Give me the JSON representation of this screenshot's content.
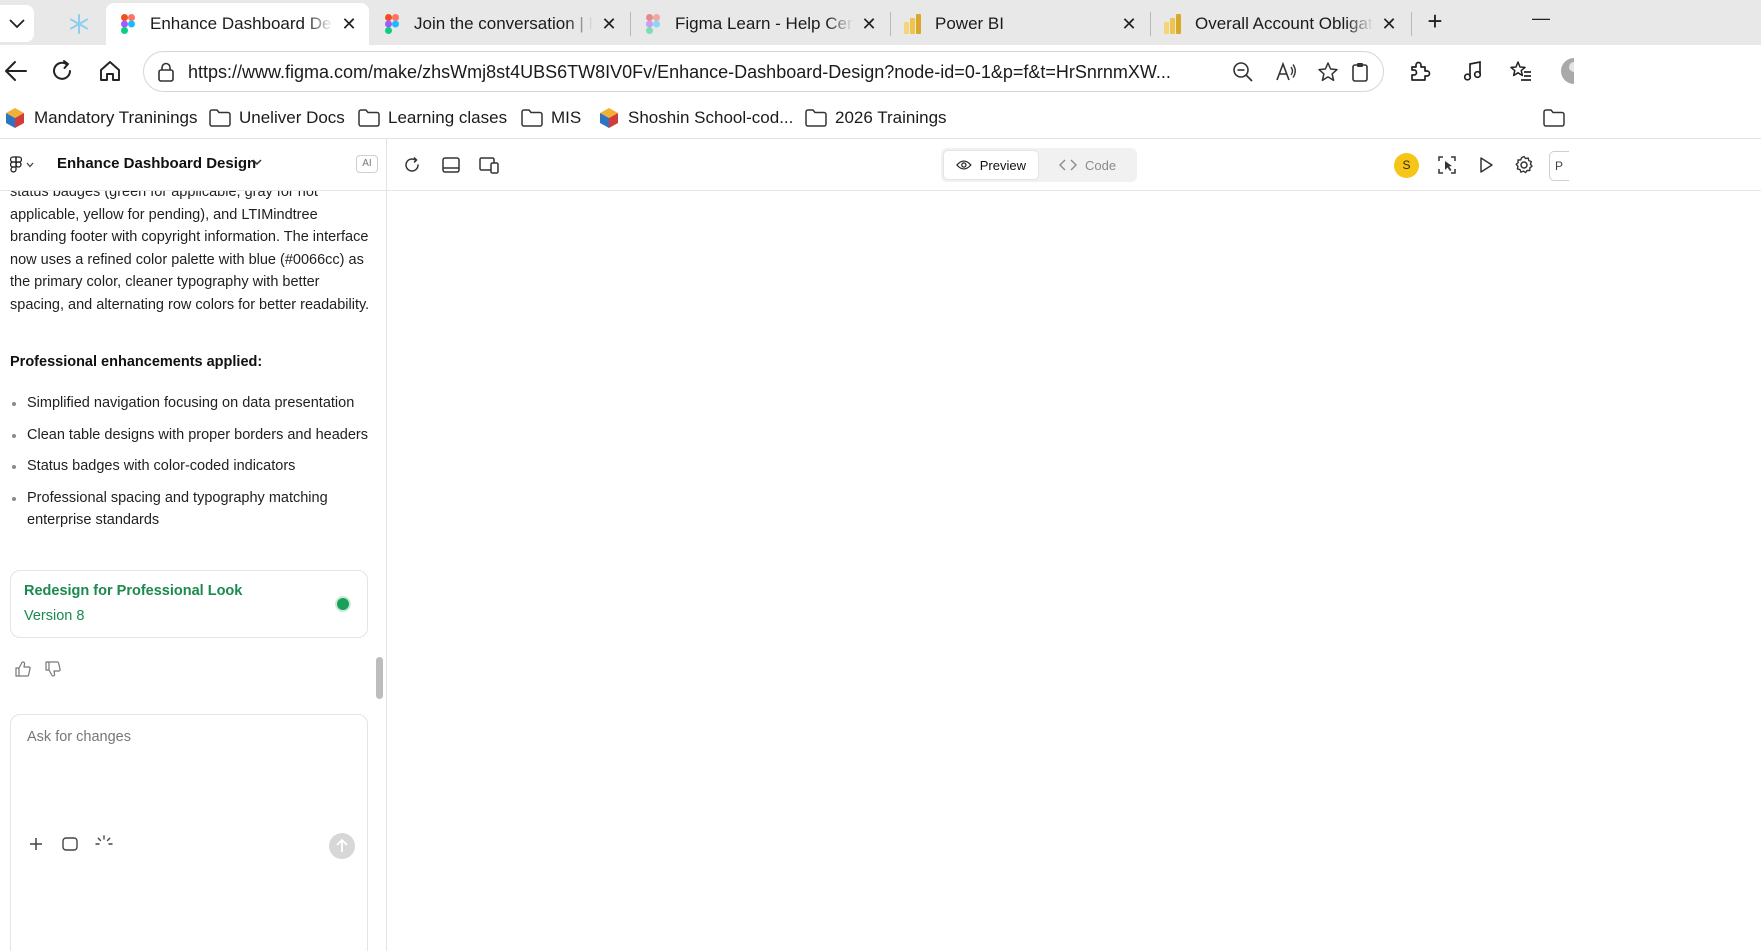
{
  "browser": {
    "tabs": [
      {
        "title": "",
        "icon": "snowflake-icon"
      },
      {
        "title": "Enhance Dashboard Design",
        "icon": "figma-icon",
        "active": true
      },
      {
        "title": "Join the conversation | Figma",
        "icon": "figma-icon"
      },
      {
        "title": "Figma Learn - Help Center",
        "icon": "figma-icon"
      },
      {
        "title": "Power BI",
        "icon": "powerbi-icon"
      },
      {
        "title": "Overall Account Obligations",
        "icon": "powerbi-icon"
      }
    ],
    "url": "https://www.figma.com/make/zhsWmj8st4UBS6TW8IV0Fv/Enhance-Dashboard-Design?node-id=0-1&p=f&t=HrSnrnmXW..."
  },
  "bookmarks": [
    {
      "label": "Mandatory Traninings",
      "icon": "cube-icon"
    },
    {
      "label": "Uneliver Docs",
      "icon": "folder-icon"
    },
    {
      "label": "Learning clases",
      "icon": "folder-icon"
    },
    {
      "label": "MIS",
      "icon": "folder-icon"
    },
    {
      "label": "Shoshin School-cod...",
      "icon": "cube-icon"
    },
    {
      "label": "2026 Trainings",
      "icon": "folder-icon"
    }
  ],
  "figma": {
    "file_title": "Enhance Dashboard Design",
    "ai_badge": "AI",
    "preview_label": "Preview",
    "code_label": "Code",
    "avatar_initial": "S",
    "right_cut_label": "P"
  },
  "chat": {
    "intro": "status badges (green for applicable, gray for not applicable, yellow for pending), and LTIMindtree branding footer with copyright information. The interface now uses a refined color palette with blue (#0066cc) as the primary color, cleaner typography with better spacing, and alternating row colors for better readability.",
    "heading": "Professional enhancements applied:",
    "bullets": [
      "Simplified navigation focusing on data presentation",
      "Clean table designs with proper borders and headers",
      "Status badges with color-coded indicators",
      "Professional spacing and typography matching enterprise standards"
    ],
    "version_card": {
      "title": "Redesign for Professional Look",
      "version": "Version 8"
    },
    "input_placeholder": "Ask for changes"
  },
  "colors": {
    "accent_green": "#1a8a4e",
    "avatar_yellow": "#f5c518",
    "primary_blue": "#0066cc"
  }
}
